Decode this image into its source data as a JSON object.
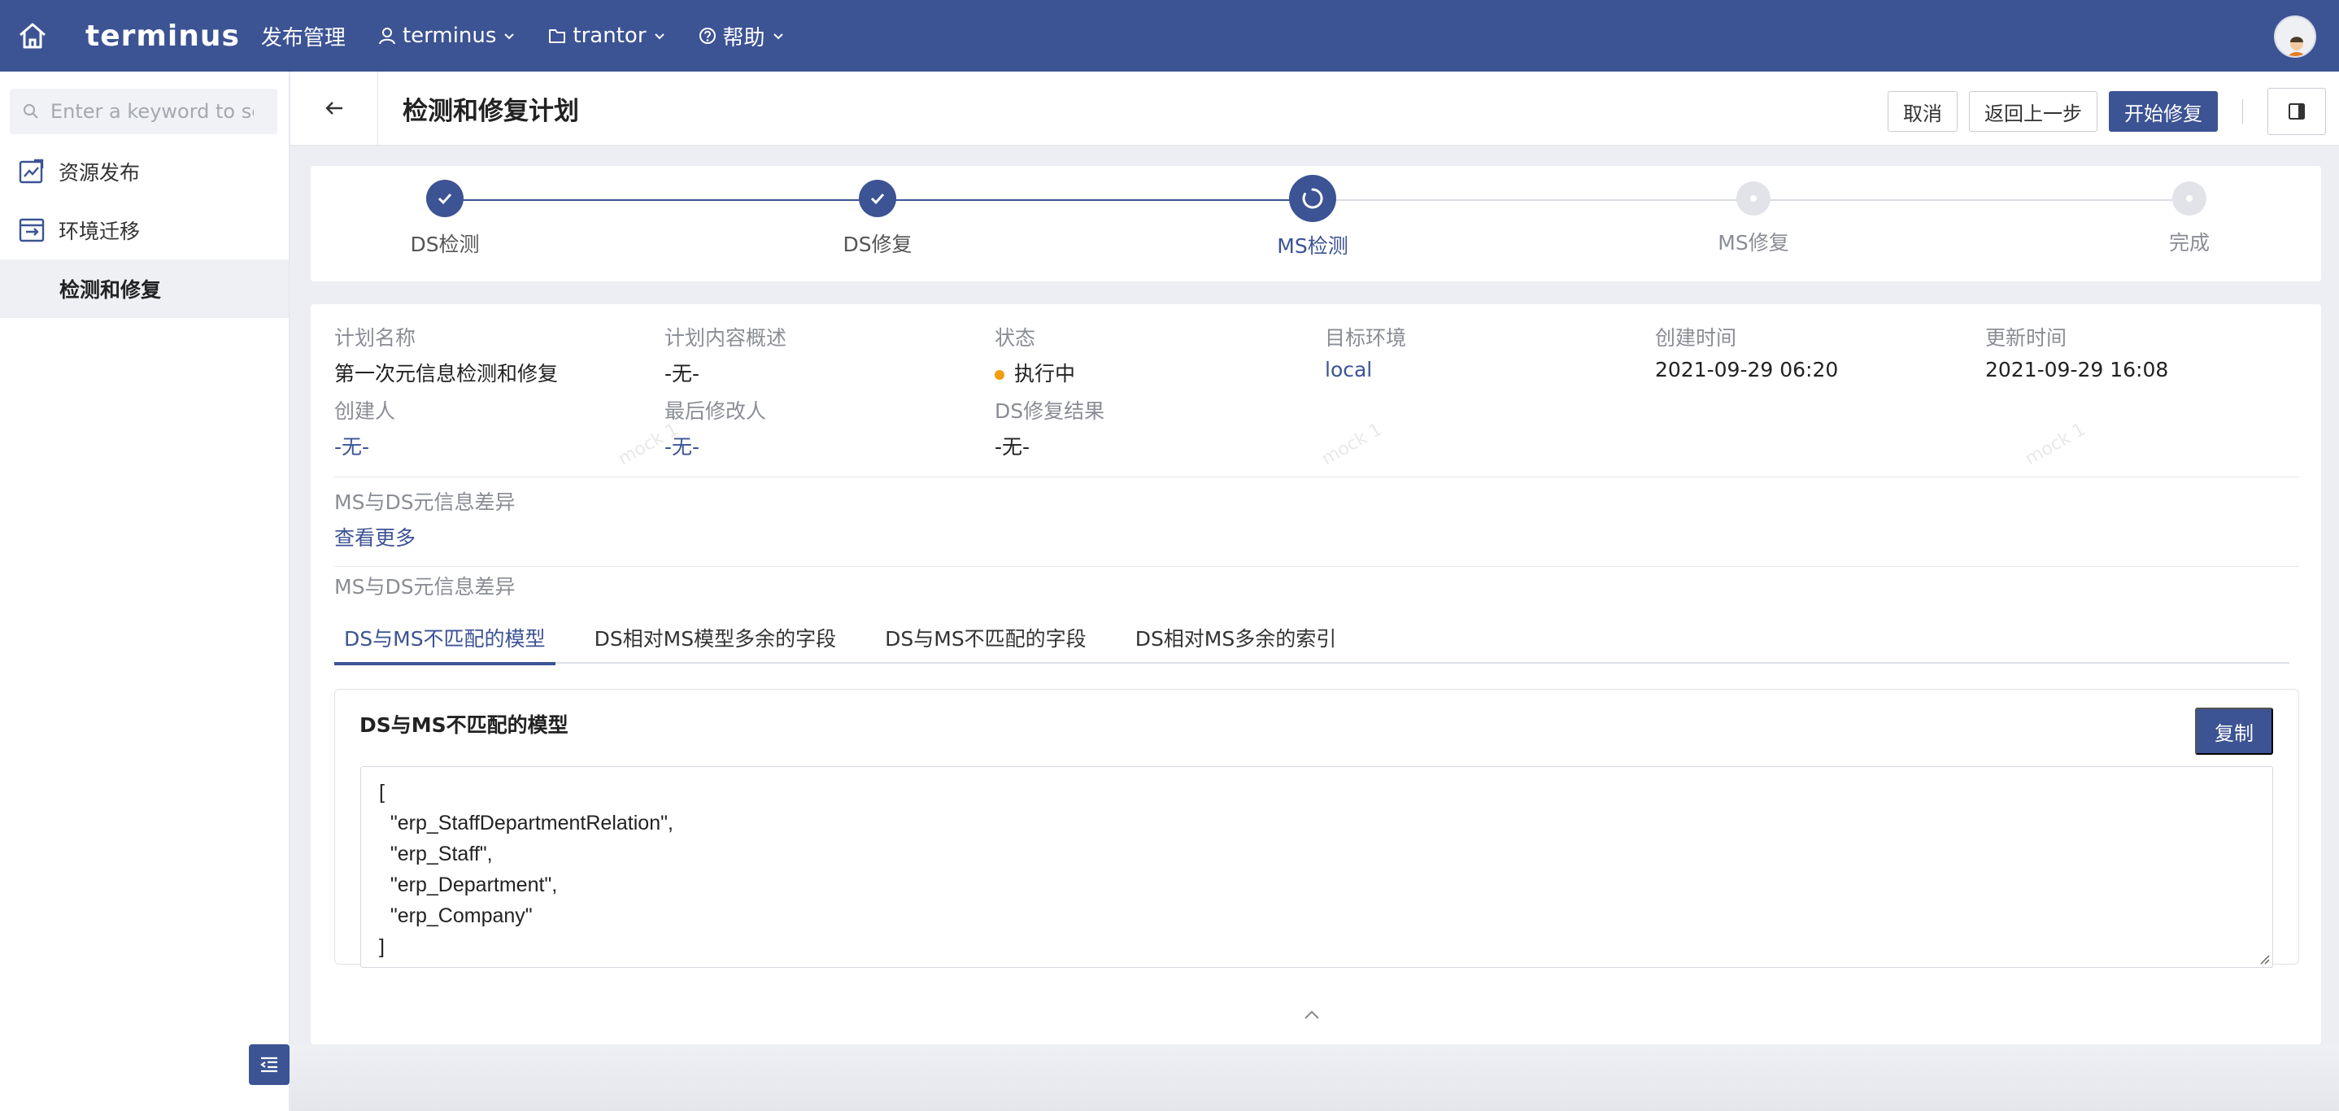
{
  "topbar": {
    "logo": "terminus",
    "title": "发布管理",
    "nav": [
      {
        "label": "terminus",
        "icon": "user-icon"
      },
      {
        "label": "trantor",
        "icon": "folder-icon"
      },
      {
        "label": "帮助",
        "icon": "help-circle-icon"
      }
    ]
  },
  "sidebar": {
    "search_placeholder": "Enter a keyword to search",
    "items": [
      {
        "label": "资源发布",
        "icon": "publish-icon"
      },
      {
        "label": "环境迁移",
        "icon": "migrate-icon"
      }
    ],
    "sub_items": [
      {
        "label": "检测和修复",
        "active": true
      }
    ]
  },
  "header": {
    "title": "检测和修复计划",
    "cancel_label": "取消",
    "prev_label": "返回上一步",
    "start_label": "开始修复"
  },
  "steps": [
    {
      "label": "DS检测",
      "state": "done"
    },
    {
      "label": "DS修复",
      "state": "done"
    },
    {
      "label": "MS检测",
      "state": "active"
    },
    {
      "label": "MS修复",
      "state": "pending"
    },
    {
      "label": "完成",
      "state": "pending"
    }
  ],
  "info": {
    "plan_name_label": "计划名称",
    "plan_name": "第一次元信息检测和修复",
    "summary_label": "计划内容概述",
    "summary": "-无-",
    "status_label": "状态",
    "status": "执行中",
    "status_color": "#f39c12",
    "env_label": "目标环境",
    "env": "local",
    "created_label": "创建时间",
    "created": "2021-09-29 06:20",
    "updated_label": "更新时间",
    "updated": "2021-09-29 16:08",
    "creator_label": "创建人",
    "creator": "-无-",
    "modifier_label": "最后修改人",
    "modifier": "-无-",
    "ds_result_label": "DS修复结果",
    "ds_result": "-无-",
    "diff_label": "MS与DS元信息差异",
    "view_more": "查看更多",
    "diff_label2": "MS与DS元信息差异"
  },
  "tabs": [
    {
      "label": "DS与MS不匹配的模型",
      "active": true
    },
    {
      "label": "DS相对MS模型多余的字段",
      "active": false
    },
    {
      "label": "DS与MS不匹配的字段",
      "active": false
    },
    {
      "label": "DS相对MS多余的索引",
      "active": false
    }
  ],
  "panel": {
    "title": "DS与MS不匹配的模型",
    "copy_label": "复制",
    "code_lines": [
      "[",
      "  \"erp_StaffDepartmentRelation\",",
      "  \"erp_Staff\",",
      "  \"erp_Department\",",
      "  \"erp_Company\"",
      "]"
    ]
  },
  "watermark": "mock 1",
  "colors": {
    "primary": "#3c5394",
    "status": "#f39c12"
  }
}
